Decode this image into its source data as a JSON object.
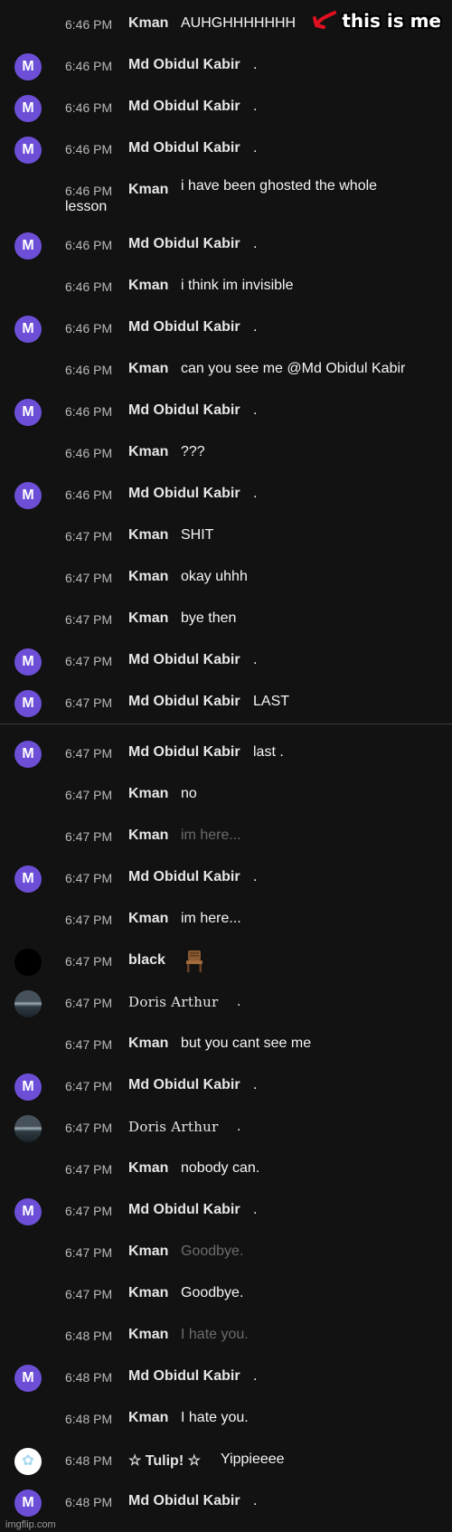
{
  "overlay": {
    "label": "this is me"
  },
  "watermark": "imgflip.com",
  "messages": [
    {
      "time": "6:46 PM",
      "author": "Kman",
      "text": "AUHGHHHHHHH",
      "avatar": "kman"
    },
    {
      "time": "6:46 PM",
      "author": "Md Obidul Kabir",
      "text": ".",
      "avatar": "m"
    },
    {
      "time": "6:46 PM",
      "author": "Md Obidul Kabir",
      "text": ".",
      "avatar": "m"
    },
    {
      "time": "6:46 PM",
      "author": "Md Obidul Kabir",
      "text": ".",
      "avatar": "m"
    },
    {
      "time": "6:46 PM",
      "author": "Kman",
      "text": "i have been ghosted the whole",
      "text2": "lesson",
      "avatar": "kman"
    },
    {
      "time": "6:46 PM",
      "author": "Md Obidul Kabir",
      "text": ".",
      "avatar": "m"
    },
    {
      "time": "6:46 PM",
      "author": "Kman",
      "text": "i think im invisible",
      "avatar": "kman"
    },
    {
      "time": "6:46 PM",
      "author": "Md Obidul Kabir",
      "text": ".",
      "avatar": "m"
    },
    {
      "time": "6:46 PM",
      "author": "Kman",
      "text": "can you see me @Md Obidul Kabir",
      "avatar": "kman"
    },
    {
      "time": "6:46 PM",
      "author": "Md Obidul Kabir",
      "text": ".",
      "avatar": "m"
    },
    {
      "time": "6:46 PM",
      "author": "Kman",
      "text": "???",
      "avatar": "kman"
    },
    {
      "time": "6:46 PM",
      "author": "Md Obidul Kabir",
      "text": ".",
      "avatar": "m"
    },
    {
      "time": "6:47 PM",
      "author": "Kman",
      "text": "SHIT",
      "avatar": "kman"
    },
    {
      "time": "6:47 PM",
      "author": "Kman",
      "text": "okay uhhh",
      "avatar": "kman"
    },
    {
      "time": "6:47 PM",
      "author": "Kman",
      "text": "bye then",
      "avatar": "kman"
    },
    {
      "time": "6:47 PM",
      "author": "Md Obidul Kabir",
      "text": ".",
      "avatar": "m"
    },
    {
      "time": "6:47 PM",
      "author": "Md Obidul Kabir",
      "text": "LAST",
      "avatar": "m"
    },
    {
      "time": "6:47 PM",
      "author": "Md Obidul Kabir",
      "text": "last .",
      "avatar": "m"
    },
    {
      "time": "6:47 PM",
      "author": "Kman",
      "text": "no",
      "avatar": "kman"
    },
    {
      "time": "6:47 PM",
      "author": "Kman",
      "text": "im here...",
      "avatar": "kman",
      "dim": true
    },
    {
      "time": "6:47 PM",
      "author": "Md Obidul Kabir",
      "text": ".",
      "avatar": "m"
    },
    {
      "time": "6:47 PM",
      "author": "Kman",
      "text": "im here...",
      "avatar": "kman"
    },
    {
      "time": "6:47 PM",
      "author": "black",
      "text": "",
      "avatar": "black",
      "icon": "chair-icon"
    },
    {
      "time": "6:47 PM",
      "author": "Doris Arthur",
      "text": ".",
      "avatar": "doris",
      "mono": true
    },
    {
      "time": "6:47 PM",
      "author": "Kman",
      "text": "but you cant see me",
      "avatar": "kman"
    },
    {
      "time": "6:47 PM",
      "author": "Md Obidul Kabir",
      "text": ".",
      "avatar": "m"
    },
    {
      "time": "6:47 PM",
      "author": "Doris Arthur",
      "text": ".",
      "avatar": "doris",
      "mono": true
    },
    {
      "time": "6:47 PM",
      "author": "Kman",
      "text": "nobody can.",
      "avatar": "kman"
    },
    {
      "time": "6:47 PM",
      "author": "Md Obidul Kabir",
      "text": ".",
      "avatar": "m"
    },
    {
      "time": "6:47 PM",
      "author": "Kman",
      "text": "Goodbye.",
      "avatar": "kman",
      "dim": true
    },
    {
      "time": "6:47 PM",
      "author": "Kman",
      "text": "Goodbye.",
      "avatar": "kman"
    },
    {
      "time": "6:48 PM",
      "author": "Kman",
      "text": "I hate you.",
      "avatar": "kman",
      "dim": true
    },
    {
      "time": "6:48 PM",
      "author": "Md Obidul Kabir",
      "text": ".",
      "avatar": "m"
    },
    {
      "time": "6:48 PM",
      "author": "Kman",
      "text": "I hate you.",
      "avatar": "kman"
    },
    {
      "time": "6:48 PM",
      "author": "☆ Tulip! ☆",
      "text": "Yippieeee",
      "avatar": "tulip"
    },
    {
      "time": "6:48 PM",
      "author": "Md Obidul Kabir",
      "text": ".",
      "avatar": "m"
    }
  ]
}
